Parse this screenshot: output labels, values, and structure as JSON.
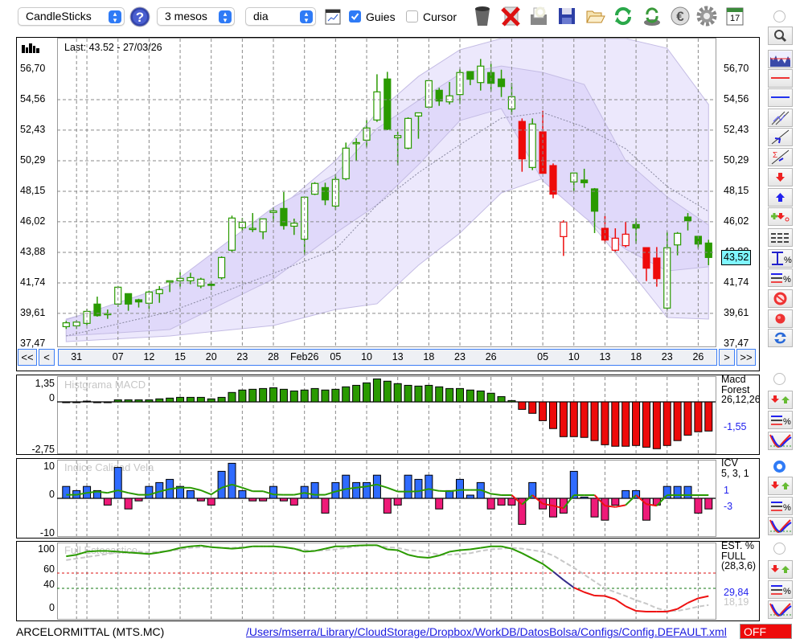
{
  "toolbar": {
    "chart_type": "CandleSticks",
    "period": "3 mesos",
    "interval": "dia",
    "guides_label": "Guies",
    "guides_checked": true,
    "cursor_label": "Cursor",
    "cursor_checked": false,
    "icons": [
      "help-icon",
      "chart-settings-icon",
      "trash-icon",
      "delete-icon",
      "print-preview-icon",
      "save-icon",
      "folder-icon",
      "refresh-icon",
      "money-refresh-icon",
      "euro-icon",
      "gear-icon",
      "calendar-icon"
    ],
    "calendar_day": "17"
  },
  "main": {
    "last_label": "Last: 43.52 - 27/03/26",
    "price_labels": [
      "56,70",
      "54,56",
      "52,43",
      "50,29",
      "48,15",
      "46,02",
      "43,88",
      "41,74",
      "39,61",
      "37,47"
    ],
    "price_levels": [
      56.7,
      54.56,
      52.43,
      50.29,
      48.15,
      46.02,
      43.88,
      41.74,
      39.61,
      37.47
    ],
    "current_price": "43,52",
    "current_value": 43.52,
    "colors": {
      "green": "#2a9a00",
      "red": "#ee0a0a",
      "band_outer": "#ece8fc",
      "band_inner": "#e0d9fa",
      "current_bg": "#7ff6ff"
    }
  },
  "nav": {
    "first": "<<",
    "prev": "<",
    "next": ">",
    "last": ">>",
    "dates": [
      {
        "label": "31",
        "at": 1
      },
      {
        "label": "07",
        "at": 5
      },
      {
        "label": "12",
        "at": 8
      },
      {
        "label": "15",
        "at": 11
      },
      {
        "label": "20",
        "at": 14
      },
      {
        "label": "23",
        "at": 17
      },
      {
        "label": "28",
        "at": 20
      },
      {
        "label": "Feb26",
        "at": 23
      },
      {
        "label": "05",
        "at": 26
      },
      {
        "label": "10",
        "at": 29
      },
      {
        "label": "13",
        "at": 32
      },
      {
        "label": "18",
        "at": 35
      },
      {
        "label": "23",
        "at": 38
      },
      {
        "label": "26",
        "at": 41
      },
      {
        "label": "05",
        "at": 46
      },
      {
        "label": "10",
        "at": 49
      },
      {
        "label": "13",
        "at": 52
      },
      {
        "label": "18",
        "at": 55
      },
      {
        "label": "23",
        "at": 58
      },
      {
        "label": "26",
        "at": 61
      }
    ],
    "grid_at": [
      1,
      2,
      5,
      8,
      11,
      14,
      17,
      20,
      23,
      26,
      29,
      32,
      35,
      38,
      41,
      43,
      46,
      49,
      52,
      55,
      58,
      61
    ]
  },
  "chart_data": [
    {
      "type": "candlestick",
      "title": "ARCELORMITTAL (MTS.MC)",
      "ylim": [
        37.47,
        56.7
      ],
      "candles": [
        [
          38.68,
          39.08,
          38.52,
          38.95,
          "g"
        ],
        [
          38.74,
          39.13,
          38.52,
          39.0,
          "g"
        ],
        [
          38.91,
          39.94,
          38.78,
          39.75,
          "g"
        ],
        [
          40.26,
          40.78,
          39.38,
          39.45,
          "g"
        ],
        [
          39.57,
          39.88,
          39.23,
          39.6,
          "g"
        ],
        [
          40.26,
          41.53,
          40.07,
          41.44,
          "g"
        ],
        [
          40.99,
          40.99,
          39.79,
          40.26,
          "g"
        ],
        [
          40.56,
          40.63,
          40.02,
          40.41,
          "g"
        ],
        [
          40.32,
          41.2,
          39.94,
          41.1,
          "g"
        ],
        [
          40.99,
          41.52,
          40.35,
          41.27,
          "g"
        ],
        [
          41.87,
          41.89,
          41.1,
          41.89,
          "g"
        ],
        [
          41.89,
          42.49,
          41.44,
          42.06,
          "g"
        ],
        [
          41.89,
          42.45,
          41.65,
          42.11,
          "g"
        ],
        [
          41.52,
          42.1,
          41.37,
          42.0,
          "g"
        ],
        [
          41.65,
          41.85,
          41.25,
          41.61,
          "g"
        ],
        [
          42.1,
          43.6,
          41.98,
          43.52,
          "g"
        ],
        [
          44.03,
          46.45,
          43.91,
          46.28,
          "g"
        ],
        [
          45.6,
          46.28,
          45.38,
          45.98,
          "g"
        ],
        [
          45.53,
          46.63,
          45.3,
          45.56,
          "g"
        ],
        [
          45.32,
          46.22,
          44.8,
          46.22,
          "g"
        ],
        [
          46.67,
          47.01,
          45.98,
          46.78,
          "g"
        ],
        [
          46.95,
          48.1,
          45.47,
          45.75,
          "g"
        ],
        [
          45.71,
          46.24,
          45.1,
          45.92,
          "g"
        ],
        [
          44.8,
          47.74,
          43.73,
          47.74,
          "g"
        ],
        [
          47.95,
          48.79,
          47.89,
          48.7,
          "g"
        ],
        [
          48.41,
          48.75,
          47.18,
          47.55,
          "g"
        ],
        [
          47.12,
          49.33,
          46.84,
          48.98,
          "g"
        ],
        [
          49.03,
          51.56,
          48.92,
          51.17,
          "g"
        ],
        [
          51.53,
          51.86,
          50.29,
          51.56,
          "g"
        ],
        [
          51.73,
          53.14,
          51.23,
          52.58,
          "g"
        ],
        [
          53.14,
          56.34,
          53.01,
          55.11,
          "g"
        ],
        [
          56.01,
          56.51,
          52.43,
          52.5,
          "g"
        ],
        [
          51.9,
          52.31,
          49.95,
          52.05,
          "g"
        ],
        [
          51.17,
          53.33,
          51.09,
          53.25,
          "g"
        ],
        [
          53.42,
          53.64,
          51.83,
          53.64,
          "g"
        ],
        [
          54.04,
          55.89,
          54.04,
          55.89,
          "g"
        ],
        [
          55.22,
          55.39,
          54.13,
          54.47,
          "g"
        ],
        [
          54.41,
          55.8,
          54.23,
          54.83,
          "g"
        ],
        [
          54.92,
          56.72,
          54.26,
          56.46,
          "g"
        ],
        [
          56.53,
          56.53,
          55.58,
          55.99,
          "g"
        ],
        [
          55.76,
          57.41,
          55.2,
          56.91,
          "g"
        ],
        [
          56.46,
          57.08,
          55.14,
          55.71,
          "g"
        ],
        [
          56.01,
          56.66,
          54.75,
          55.48,
          "g"
        ],
        [
          53.91,
          55.73,
          53.51,
          54.77,
          "g"
        ],
        [
          53.04,
          53.25,
          49.52,
          50.42,
          "r"
        ],
        [
          49.82,
          53.25,
          49.63,
          52.86,
          "g"
        ],
        [
          52.31,
          53.79,
          49.41,
          49.41,
          "r"
        ],
        [
          49.95,
          50.1,
          47.66,
          47.95,
          "r"
        ],
        [
          44.98,
          46.13,
          43.63,
          46.0,
          "r"
        ],
        [
          48.81,
          49.43,
          48.13,
          49.43,
          "g"
        ],
        [
          48.94,
          49.73,
          48.4,
          48.75,
          "g"
        ],
        [
          48.32,
          48.38,
          45.23,
          46.76,
          "g"
        ],
        [
          45.56,
          46.41,
          44.51,
          44.74,
          "r"
        ],
        [
          44.03,
          45.56,
          43.93,
          44.87,
          "r"
        ],
        [
          44.35,
          46.01,
          44.23,
          45.15,
          "r"
        ],
        [
          45.83,
          46.26,
          44.48,
          45.58,
          "g"
        ],
        [
          44.21,
          44.21,
          41.87,
          42.77,
          "r"
        ],
        [
          43.48,
          44.25,
          41.48,
          42.04,
          "r"
        ],
        [
          39.98,
          45.32,
          39.83,
          44.2,
          "g"
        ],
        [
          44.4,
          45.3,
          43.67,
          45.21,
          "g"
        ],
        [
          46.35,
          46.63,
          45.41,
          46.09,
          "g"
        ],
        [
          45.0,
          45.0,
          44.14,
          44.46,
          "g"
        ],
        [
          44.53,
          44.76,
          42.98,
          43.52,
          "g"
        ]
      ],
      "bands": {
        "at": [
          0,
          10,
          20,
          26,
          30,
          34,
          38,
          42,
          46,
          50,
          54,
          58,
          62
        ],
        "outer_upper": [
          39.21,
          41.18,
          46.63,
          50.29,
          53.66,
          56.19,
          58.05,
          58.84,
          58.84,
          58.84,
          58.84,
          58.16,
          54.23
        ],
        "outer_lower": [
          37.63,
          38.03,
          38.76,
          39.88,
          40.28,
          42.98,
          45.23,
          48.04,
          49.05,
          46.46,
          42.98,
          39.32,
          39.21
        ],
        "inner_upper": [
          39.15,
          41.57,
          47.03,
          49.33,
          52.54,
          54.51,
          56.36,
          56.92,
          56.47,
          55.63,
          50.29,
          47.76,
          45.79
        ],
        "inner_lower": [
          38.03,
          38.48,
          42.02,
          45.23,
          47.2,
          50.01,
          53.1,
          53.94,
          48.88,
          46.35,
          44.1,
          42.58,
          42.87
        ],
        "ma": [
          38.03,
          39.72,
          42.41,
          44.1,
          47.2,
          49.45,
          51.41,
          53.27,
          53.66,
          52.65,
          51.13,
          48.49,
          46.74
        ]
      }
    },
    {
      "type": "bar",
      "title": "Histgrama MACD",
      "ylim": [
        -2.75,
        1.35
      ],
      "ytick_labels": [
        "1,35",
        "0",
        "-2,75"
      ],
      "legend": [
        "Macd",
        "Forest",
        "26,12,26"
      ],
      "last_value": "-1,55",
      "values": [
        0,
        0,
        0.04,
        0,
        0,
        0.11,
        0.11,
        0.11,
        0.11,
        0.16,
        0.2,
        0.24,
        0.24,
        0.24,
        0.16,
        0.24,
        0.5,
        0.63,
        0.67,
        0.71,
        0.75,
        0.67,
        0.58,
        0.63,
        0.71,
        0.63,
        0.67,
        0.8,
        0.88,
        1.01,
        1.22,
        1.1,
        0.97,
        0.88,
        0.84,
        0.88,
        0.8,
        0.71,
        0.71,
        0.63,
        0.58,
        0.46,
        0.28,
        0.07,
        -0.4,
        -0.61,
        -1.0,
        -1.42,
        -1.85,
        -1.85,
        -1.89,
        -2.06,
        -2.28,
        -2.36,
        -2.36,
        -2.32,
        -2.41,
        -2.49,
        -2.32,
        -2.06,
        -1.77,
        -1.59,
        -1.55
      ]
    },
    {
      "type": "bar",
      "title": "Indice Calidad Vela",
      "ylim": [
        -10,
        10
      ],
      "ytick_labels": [
        "10",
        "0",
        "-10"
      ],
      "legend": [
        "ICV",
        "5, 3, 1"
      ],
      "signal_value": "1",
      "last_value": "-3",
      "values": [
        3.7,
        2.4,
        3.7,
        2.4,
        -2.1,
        9.6,
        -3.3,
        -0.8,
        3.7,
        4.9,
        5.9,
        3.7,
        2.4,
        -0.8,
        -2.1,
        8.4,
        10.9,
        2.4,
        -0.8,
        -0.8,
        3.7,
        -0.8,
        -2.1,
        3.7,
        4.9,
        -4.6,
        4.9,
        7.2,
        4.9,
        4.9,
        7.2,
        -4.6,
        -2.1,
        7.2,
        5.9,
        7.2,
        -3.3,
        2.4,
        5.9,
        1,
        4.9,
        -3.3,
        -2.1,
        -2.1,
        -8.1,
        4.9,
        -3.3,
        -5.8,
        -4.6,
        8.4,
        0.4,
        -5.8,
        -6.8,
        -2.1,
        2.4,
        2.4,
        -6.8,
        -2.1,
        3.7,
        3.7,
        3.7,
        -4.6,
        -3.3
      ],
      "signal": [
        1.1,
        1.1,
        1.7,
        2.1,
        1.7,
        2.5,
        1.7,
        1.1,
        1.1,
        2.1,
        2.9,
        3.3,
        3.3,
        2.5,
        1.2,
        3.3,
        4.3,
        3.3,
        2.2,
        2.2,
        1.2,
        1.1,
        1.1,
        1.7,
        1.1,
        1.1,
        2.1,
        2.9,
        3.3,
        3.7,
        4.3,
        3.3,
        2.1,
        2.1,
        2.2,
        2.9,
        2.3,
        2.2,
        2.6,
        2.6,
        2.6,
        1.4,
        1,
        1,
        -1.9,
        1,
        -1.7,
        -2.3,
        -3.1,
        1,
        1,
        1,
        -2.3,
        -2.7,
        -2.1,
        1,
        -1.8,
        -2.3,
        1,
        1,
        1,
        1,
        1
      ]
    },
    {
      "type": "line",
      "title": "Full Estocastico",
      "ylim": [
        0,
        100
      ],
      "ytick_labels": [
        "100",
        "60",
        "40",
        "0"
      ],
      "legend": [
        "EST. %",
        "FULL",
        "(28,3,6)"
      ],
      "k_value": "29,84",
      "d_value": "18,19",
      "levels": [
        60,
        40
      ],
      "k": [
        82,
        84,
        88,
        89,
        89,
        88,
        87,
        86,
        85,
        87,
        89.5,
        93,
        95,
        96,
        94,
        93,
        92,
        93,
        95,
        95,
        95,
        94,
        92,
        88,
        89,
        92,
        95,
        95,
        96,
        96.5,
        96.5,
        91,
        90,
        84,
        81,
        80,
        83,
        88,
        90,
        91,
        93,
        95,
        95,
        92,
        86,
        79,
        72,
        62,
        51,
        41,
        35,
        30.5,
        30,
        25.6,
        16.5,
        10.5,
        9.5,
        9.5,
        9.5,
        13,
        21,
        27,
        29.84
      ],
      "d": [
        77,
        79,
        81,
        83,
        85,
        87,
        88,
        88,
        87,
        88,
        89,
        91,
        93,
        94,
        94,
        93,
        93,
        94,
        95,
        95,
        95,
        94,
        92,
        90,
        89,
        90,
        91,
        93,
        95,
        96.5,
        96,
        94,
        93,
        90,
        89,
        87,
        84,
        84,
        85,
        86,
        89,
        91,
        92,
        93,
        92,
        90,
        88,
        83,
        75,
        67,
        58,
        49,
        40,
        35,
        30,
        24.5,
        20,
        14,
        10.5,
        10.5,
        13,
        16,
        18.19
      ]
    }
  ],
  "right_panel": {
    "tools": [
      "zoom-icon",
      "chart-thumbnail-icon",
      "horizontal-red-line-icon",
      "horizontal-blue-line-icon",
      "channel-icon",
      "trendline-icon",
      "sigma-trendline-icon",
      "sell-arrow-icon",
      "buy-arrow-icon",
      "add-signal-icon",
      "dashed-lines-icon",
      "range-percent-icon",
      "lines-percent-icon",
      "stop-icon",
      "record-icon",
      "sync-icon"
    ],
    "selected_indicator": 1
  },
  "status": {
    "symbol": "ARCELORMITTAL (MTS.MC)",
    "path": "/Users/mserra/Library/CloudStorage/Dropbox/WorkDB/DatosBolsa/Configs/Config.DEFAULT.xml",
    "off_label": "OFF"
  }
}
